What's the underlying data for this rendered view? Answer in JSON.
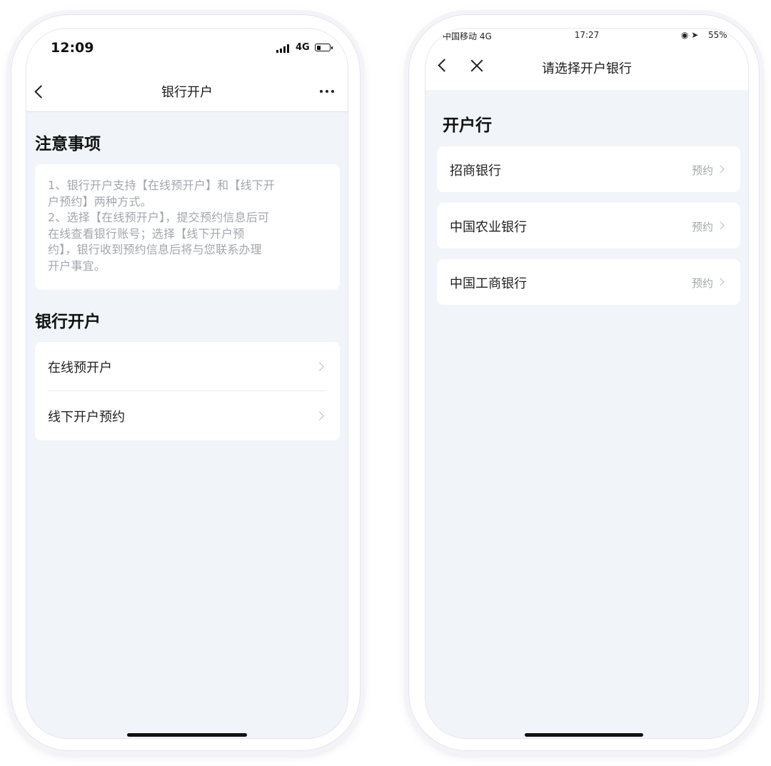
{
  "left_phone": {
    "status_bar": {
      "time": "12:09",
      "network": "4G"
    },
    "nav": {
      "title": "银行开户"
    },
    "notice": {
      "heading": "注意事项",
      "line1": "1、银行开户支持【在线预开户】和【线下开",
      "line2": "户预约】两种方式。",
      "line3": "2、选择【在线预开户】，提交预约信息后可",
      "line4": "在线查看银行账号；选择【线下开户预",
      "line5": "约】，银行收到预约信息后将与您联系办理",
      "line6": "开户事宜。"
    },
    "account_section": {
      "heading": "银行开户",
      "items": [
        {
          "label": "在线预开户"
        },
        {
          "label": "线下开户预约"
        }
      ]
    }
  },
  "right_phone": {
    "status_bar": {
      "carrier": "中国移动  4G",
      "time": "17:27",
      "battery": "55%"
    },
    "nav": {
      "title": "请选择开户银行"
    },
    "section_heading": "开户行",
    "banks": [
      {
        "name": "招商银行",
        "action": "预约"
      },
      {
        "name": "中国农业银行",
        "action": "预约"
      },
      {
        "name": "中国工商银行",
        "action": "预约"
      }
    ]
  }
}
